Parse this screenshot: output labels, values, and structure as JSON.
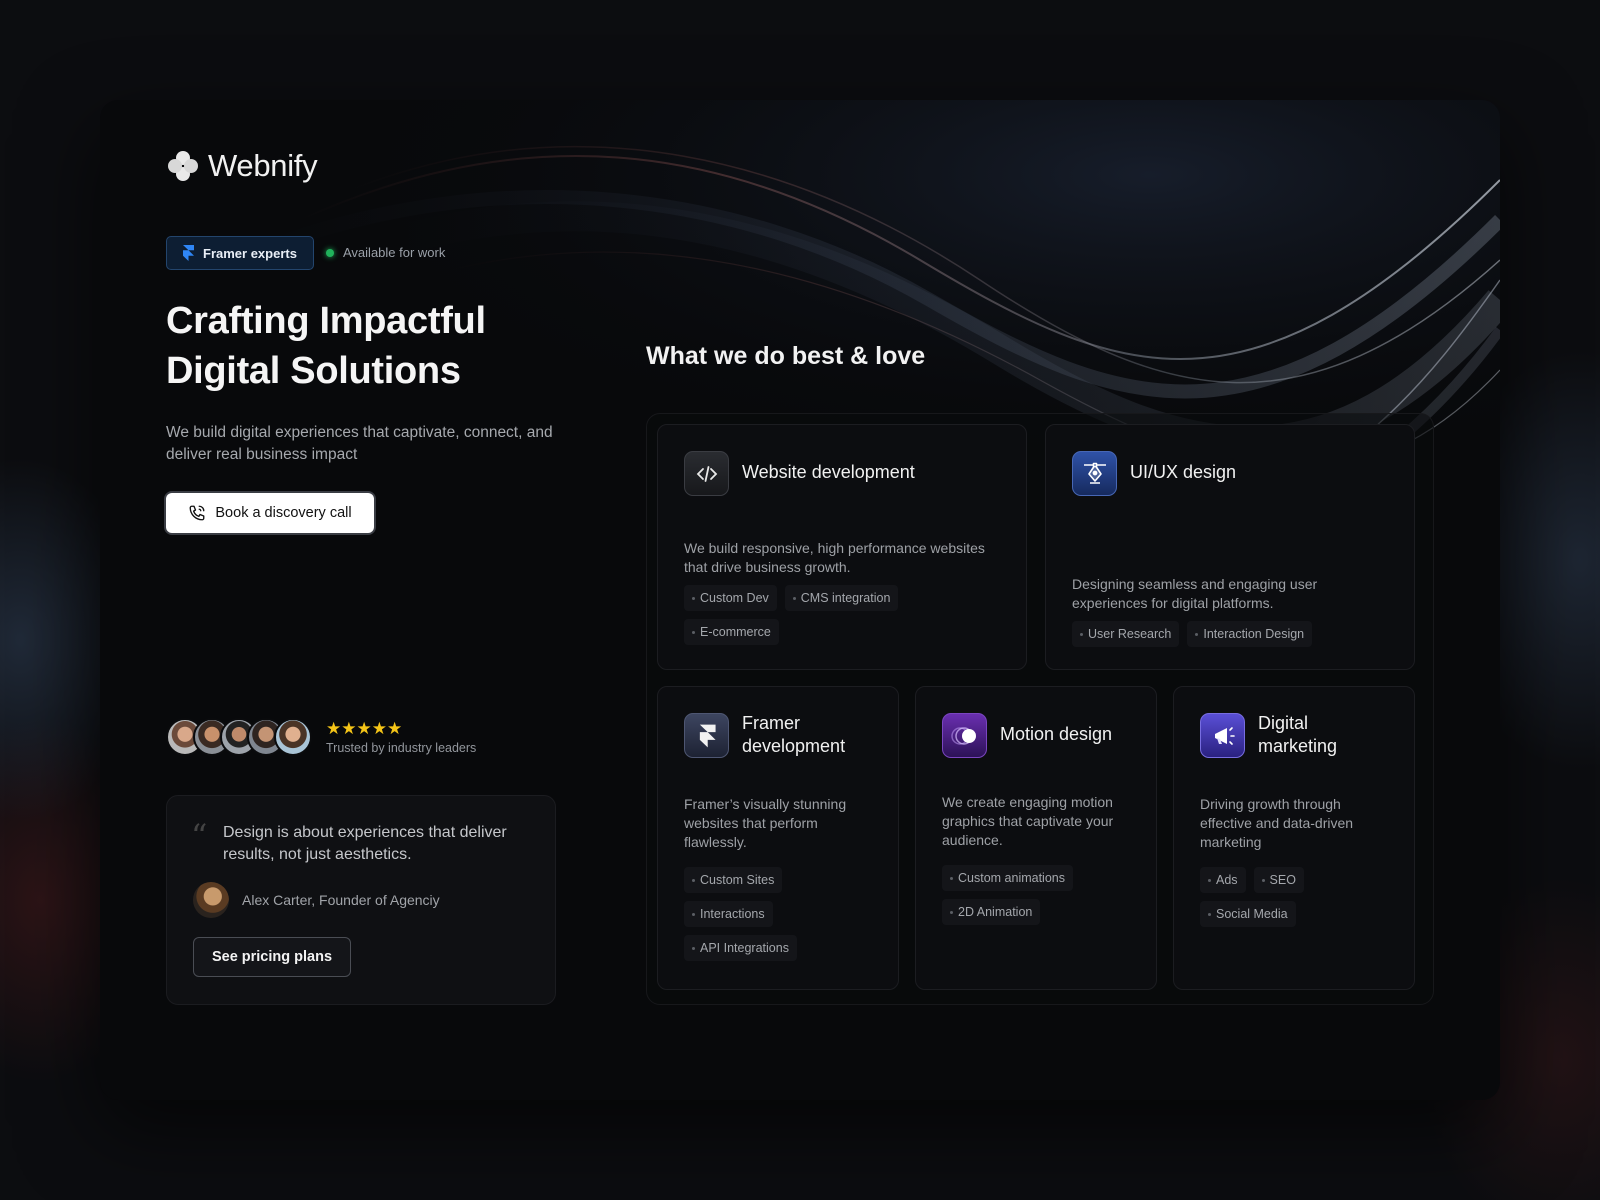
{
  "brand": {
    "name": "Webnify",
    "logo_icon": "clover-icon"
  },
  "hero": {
    "badge": "Framer experts",
    "badge_icon": "framer-icon",
    "availability": "Available for work",
    "availability_color": "#20b25b",
    "title_line1": "Crafting Impactful",
    "title_line2": "Digital Solutions",
    "subtitle": "We build digital experiences that captivate, connect, and deliver real business impact",
    "cta_label": "Book a discovery call",
    "cta_icon": "phone-icon"
  },
  "trust": {
    "rating_stars": 5,
    "stars": "★★★★★",
    "text": "Trusted by industry leaders"
  },
  "testimonial": {
    "quote": "Design is about experiences that deliver results, not just aesthetics.",
    "author": "Alex Carter, Founder of Agenciy",
    "button_label": "See pricing plans"
  },
  "services": {
    "heading": "What we do best & love",
    "items": [
      {
        "title": "Website development",
        "icon": "code-icon",
        "desc": "We build responsive, high performance websites that drive business growth.",
        "tags": [
          "Custom Dev",
          "CMS integration",
          "E-commerce"
        ]
      },
      {
        "title": "UI/UX design",
        "icon": "pen-tool-icon",
        "desc": "Designing seamless and engaging user experiences for digital platforms.",
        "tags": [
          "User Research",
          "Interaction Design"
        ]
      },
      {
        "title_line1": "Framer",
        "title_line2": "development",
        "icon": "framer-icon",
        "desc": "Framer’s visually stunning websites that perform flawlessly.",
        "tags": [
          "Custom Sites",
          "Interactions",
          "API Integrations"
        ]
      },
      {
        "title": "Motion design",
        "icon": "motion-icon",
        "desc": "We create engaging motion graphics that captivate your audience.",
        "tags": [
          "Custom animations",
          "2D Animation"
        ]
      },
      {
        "title_line1": "Digital",
        "title_line2": "marketing",
        "icon": "megaphone-icon",
        "desc": "Driving growth through effective and data-driven marketing",
        "tags": [
          "Ads",
          "SEO",
          "Social Media"
        ]
      }
    ]
  },
  "colors": {
    "accent_blue": "#1f6fe0",
    "star": "#f5c518",
    "background": "#08090b"
  }
}
